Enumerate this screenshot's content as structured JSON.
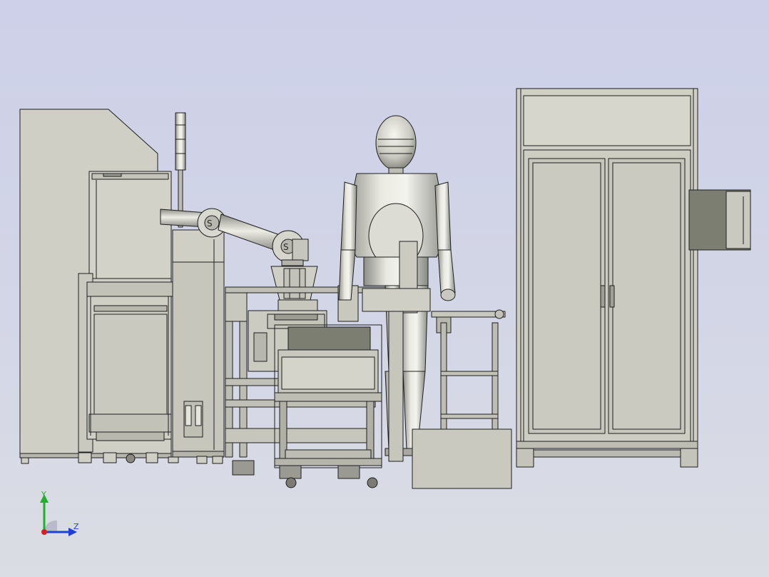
{
  "viewport": {
    "background_top": "#cdd0e8",
    "background_bottom": "#dbdde4"
  },
  "triad": {
    "y_label": "Y",
    "z_label": "Z",
    "y_color": "#1fb12a",
    "z_color": "#1f3fd6",
    "x_color": "#d62020"
  },
  "model": {
    "body_color": "#cfcfc5",
    "edge_color": "#1e1e1e",
    "dark_panel": "#7d7e72",
    "robot_grey": "#bfc0b8"
  }
}
